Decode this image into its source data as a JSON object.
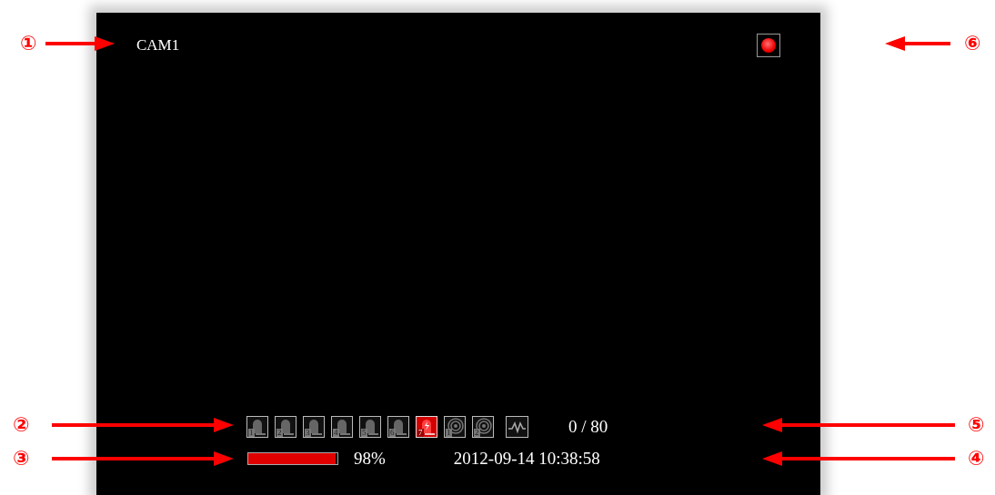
{
  "camera": {
    "name": "CAM1",
    "recording": true
  },
  "status_icons": [
    {
      "kind": "sensor",
      "label": "1",
      "triggered": false
    },
    {
      "kind": "sensor",
      "label": "2",
      "triggered": false
    },
    {
      "kind": "sensor",
      "label": "3",
      "triggered": false
    },
    {
      "kind": "sensor",
      "label": "4",
      "triggered": false
    },
    {
      "kind": "sensor",
      "label": "5",
      "triggered": false
    },
    {
      "kind": "sensor",
      "label": "6",
      "triggered": false
    },
    {
      "kind": "sensor",
      "label": "7",
      "triggered": true
    },
    {
      "kind": "motion",
      "label": "1",
      "triggered": false
    },
    {
      "kind": "motion",
      "label": "2",
      "triggered": false
    },
    {
      "kind": "video_loss",
      "triggered": false
    }
  ],
  "event_count": "0 / 80",
  "disk": {
    "level": 0.98,
    "reading": "98%"
  },
  "datetime": "2012-09-14 10:38:58",
  "callout_rows": [
    {
      "left": "①",
      "right": "⑥"
    },
    {
      "left": "②",
      "right": "⑤"
    },
    {
      "left": "③",
      "right": "④"
    }
  ]
}
